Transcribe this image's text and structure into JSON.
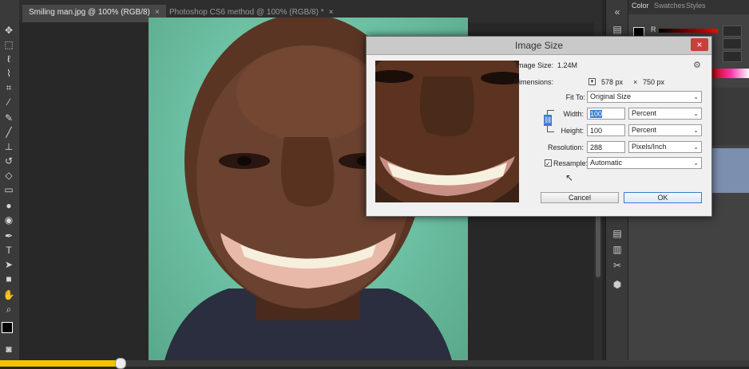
{
  "tabs": [
    {
      "label": "Smiling man.jpg @ 100% (RGB/8)",
      "active": true
    },
    {
      "label": "Photoshop CS6 method @ 100% (RGB/8) *",
      "active": false
    }
  ],
  "panels": {
    "tabs": [
      "Color",
      "Swatches",
      "Styles"
    ],
    "channel_label": "R"
  },
  "dialog": {
    "title": "Image Size",
    "close_symbol": "×",
    "image_size_label": "Image Size:",
    "image_size_value": "1.24M",
    "dimensions_label": "Dimensions:",
    "dim_width": "578 px",
    "dim_x": "×",
    "dim_height": "750 px",
    "fit_to_label": "Fit To:",
    "fit_to_value": "Original Size",
    "width_label": "Width:",
    "width_value": "100",
    "width_unit": "Percent",
    "height_label": "Height:",
    "height_value": "100",
    "height_unit": "Percent",
    "resolution_label": "Resolution:",
    "resolution_value": "288",
    "resolution_unit": "Pixels/Inch",
    "resample_label": "Resample:",
    "resample_checked": true,
    "resample_value": "Automatic",
    "cancel_label": "Cancel",
    "ok_label": "OK"
  },
  "timeline": {
    "progress": 0.16
  },
  "colors": {
    "accent": "#f0c400",
    "dialog_bg": "#f0f0f0",
    "backdrop": "#6cbfa2",
    "close": "#c7403a"
  },
  "icons": [
    "move-icon",
    "marquee-icon",
    "lasso-icon",
    "quick-select-icon",
    "crop-icon",
    "eyedropper-icon",
    "healing-brush-icon",
    "brush-icon",
    "clone-stamp-icon",
    "history-brush-icon",
    "eraser-icon",
    "gradient-icon",
    "blur-icon",
    "dodge-icon",
    "pen-icon",
    "type-icon",
    "path-select-icon",
    "rectangle-icon",
    "hand-icon",
    "zoom-icon",
    "color-swatch-icon",
    "quick-mask-icon",
    "gear-icon",
    "chain-link-icon",
    "cursor-icon"
  ]
}
